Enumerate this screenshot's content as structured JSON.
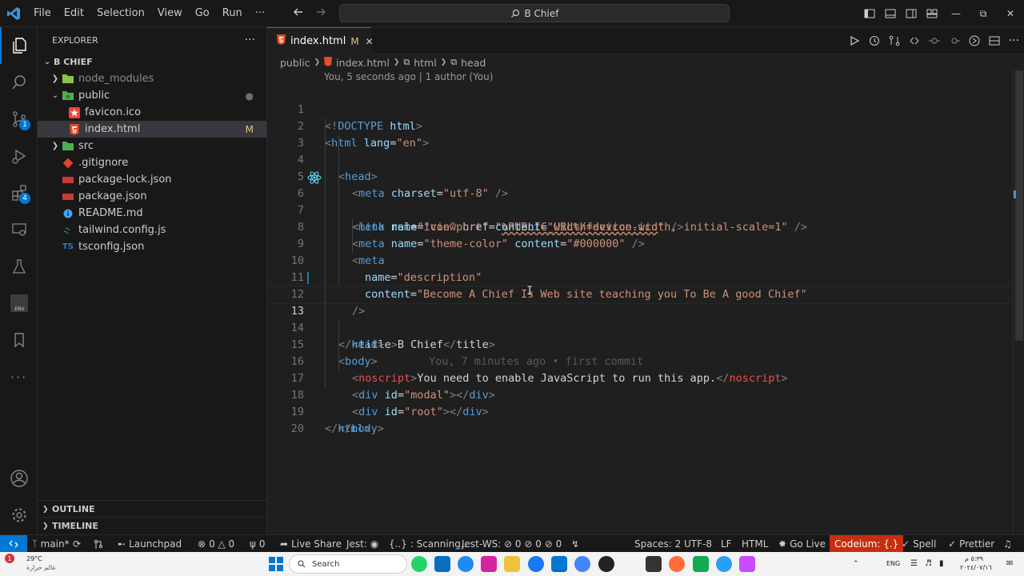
{
  "titlebar": {
    "menu": [
      "File",
      "Edit",
      "Selection",
      "View",
      "Go",
      "Run",
      "···"
    ],
    "search_text": "B Chief"
  },
  "activity": {
    "source_control_badge": "1",
    "extensions_badge": "4",
    "env_label": ".ENV"
  },
  "sidebar": {
    "title": "EXPLORER",
    "more": "···",
    "root": "B CHIEF",
    "items": [
      {
        "label": "node_modules",
        "kind": "folder-collapsed",
        "icon_color": "#8bc34a"
      },
      {
        "label": "public",
        "kind": "folder-open",
        "icon_color": "#4caf50",
        "decoration": "●"
      },
      {
        "label": "favicon.ico",
        "kind": "file",
        "icon_color": "#f44336"
      },
      {
        "label": "index.html",
        "kind": "file",
        "icon_color": "#e44d26",
        "decoration": "M"
      },
      {
        "label": "src",
        "kind": "folder-collapsed",
        "icon_color": "#4caf50"
      },
      {
        "label": ".gitignore",
        "kind": "file",
        "icon_color": "#e24329"
      },
      {
        "label": "package-lock.json",
        "kind": "file",
        "icon_color": "#cb3837"
      },
      {
        "label": "package.json",
        "kind": "file",
        "icon_color": "#cb3837"
      },
      {
        "label": "README.md",
        "kind": "file",
        "icon_color": "#42a5f5"
      },
      {
        "label": "tailwind.config.js",
        "kind": "file",
        "icon_color": "#38bdf8"
      },
      {
        "label": "tsconfig.json",
        "kind": "file",
        "icon_color": "#3178c6"
      }
    ],
    "outline": "OUTLINE",
    "timeline": "TIMELINE"
  },
  "tab": {
    "label": "index.html",
    "modified": "M"
  },
  "breadcrumbs": [
    "public",
    "index.html",
    "html",
    "head"
  ],
  "blame_header": "You, 5 seconds ago | 1 author (You)",
  "code": {
    "lines": [
      "1",
      "2",
      "3",
      "4",
      "5",
      "6",
      "7",
      "8",
      "9",
      "10",
      "11",
      "12",
      "13",
      "14",
      "15",
      "16",
      "17",
      "18",
      "19",
      "20"
    ],
    "doctype_a": "<!",
    "doctype_b": "DOCTYPE",
    "doctype_c": " html",
    "doctype_d": ">",
    "lang_value": "\"en\"",
    "charset_value": "\"utf-8\"",
    "link_rel_value": "\"icon\"",
    "link_href_value": "%PUBLIC_URL%/favicon.ico",
    "viewport_name": "\"viewport\"",
    "viewport_content": "\"width=device-width, initial-scale=1\"",
    "theme_name": "\"theme-color\"",
    "theme_content": "\"#000000\"",
    "desc_name": "\"description\"",
    "desc_content": "\"Become A Chief Is Web site teaching you To Be A good Chief\"",
    "title_text": "B Chief",
    "ghost_blame": "You, 7 minutes ago • first commit",
    "noscript_text": "You need to enable JavaScript to run this app.",
    "modal_id": "\"modal\"",
    "root_id": "\"root\""
  },
  "status": {
    "branch": "main*",
    "launchpad": "Launchpad",
    "problems": "0 △ 0",
    "ports": "0",
    "live_share": "Live Share",
    "jest": "Jest:",
    "scanning": "{..} : Scanning..",
    "jest_ws": "Jest-WS: ⊘ 0 ⊘ 0 ⊘ 0",
    "spaces": "Spaces: 2",
    "encoding": "UTF-8",
    "eol": "LF",
    "language": "HTML",
    "go_live": "Go Live",
    "codeium": "Codeium: {.}",
    "spell": "Spell",
    "prettier": "Prettier"
  },
  "taskbar": {
    "weather_temp": "29°C",
    "weather_desc": "عالم حرارة",
    "search": "Search",
    "lang": "ENG",
    "time": "٥:٣٩ م",
    "date": "٢٠٢٤/٠٧/١٦"
  }
}
